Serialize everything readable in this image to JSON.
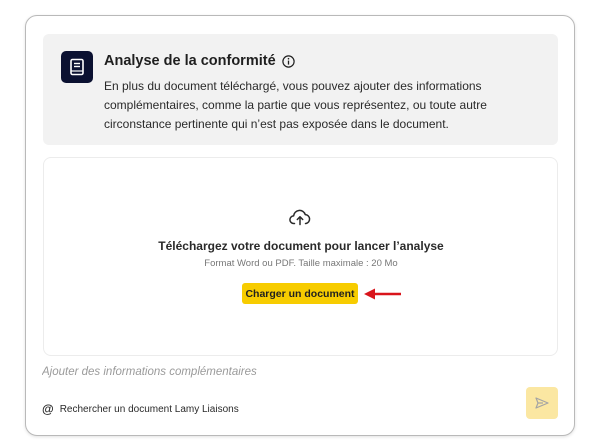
{
  "info": {
    "title": "Analyse de la conformité",
    "text": "En plus du document téléchargé, vous pouvez ajouter des informations complémentaires, comme la partie que vous représentez, ou toute autre circonstance pertinente qui n’est pas exposée dans le document.",
    "icon": "book-icon",
    "info_icon": "info-icon"
  },
  "upload": {
    "icon": "cloud-upload-icon",
    "title": "Téléchargez votre document pour lancer l’analyse",
    "subtitle": "Format Word ou PDF. Taille maximale : 20 Mo",
    "button_label": "Charger un document",
    "annotation": "red-arrow-icon"
  },
  "composer": {
    "placeholder": "Ajouter des informations complémentaires",
    "search_label": "Rechercher un document Lamy Liaisons",
    "send_icon": "send-icon"
  },
  "colors": {
    "accent": "#f7cc00",
    "send_disabled": "#fbe7a2",
    "icon_bg": "#0b1131",
    "panel_bg": "#f2f2f2",
    "annotation": "#d9141b"
  }
}
